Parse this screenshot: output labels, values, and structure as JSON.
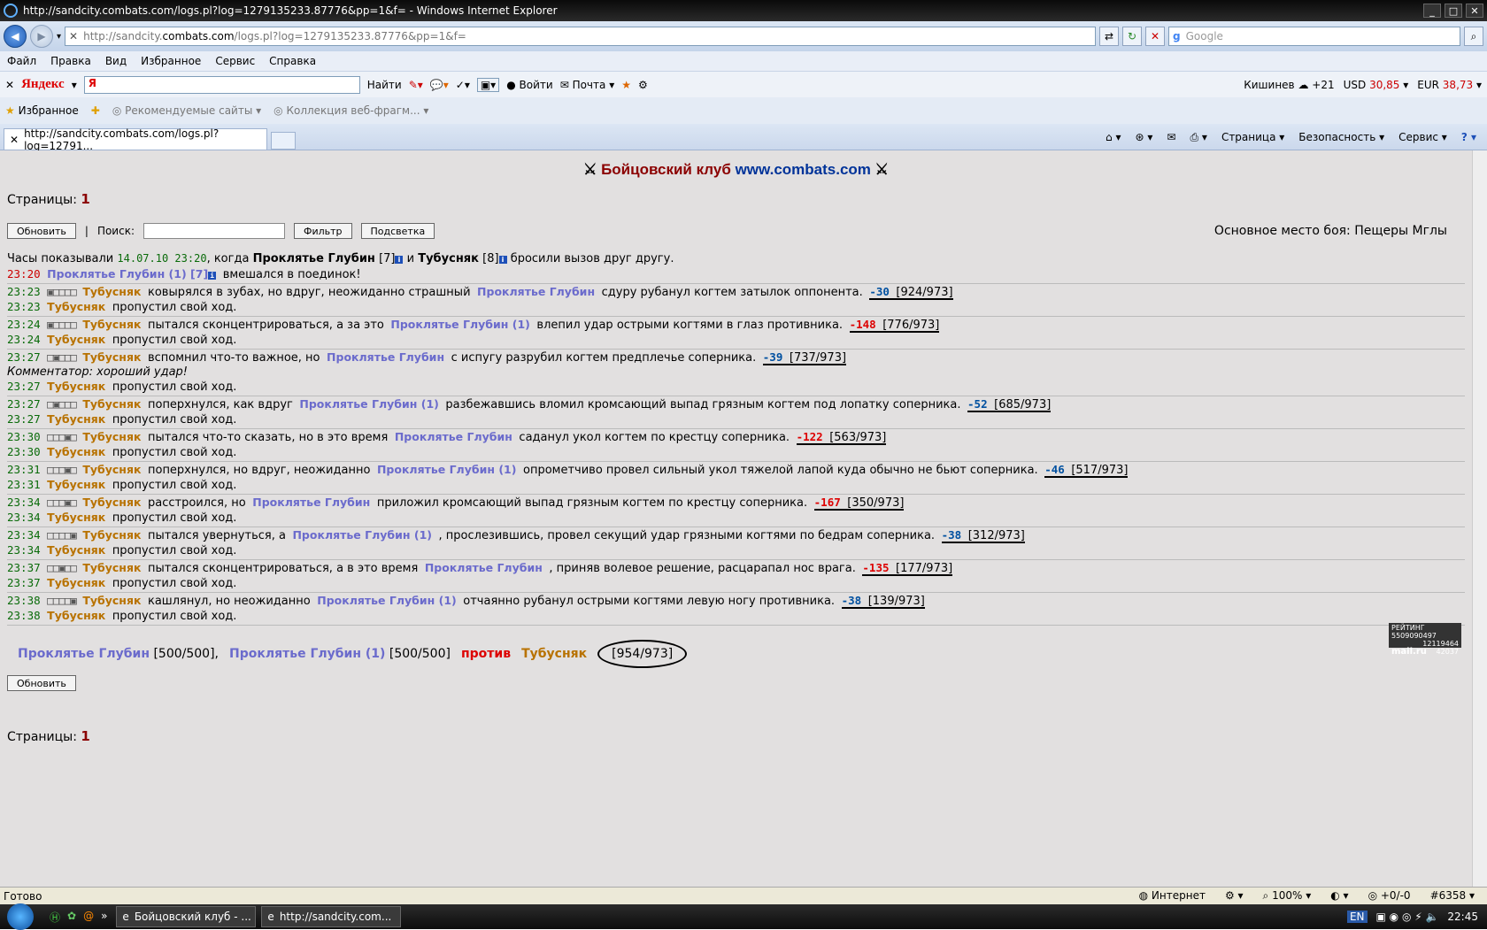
{
  "window": {
    "title": "http://sandcity.combats.com/logs.pl?log=1279135233.87776&pp=1&f= - Windows Internet Explorer"
  },
  "addressbar": {
    "url_prefix": "http://sandcity.",
    "url_domain": "combats.com",
    "url_suffix": "/logs.pl?log=1279135233.87776&pp=1&f=",
    "search_placeholder": "Google"
  },
  "menu": [
    "Файл",
    "Правка",
    "Вид",
    "Избранное",
    "Сервис",
    "Справка"
  ],
  "yandex": {
    "logo": "Яндекс",
    "input": "Я",
    "find": "Найти",
    "login": "Войти",
    "mail": "Почта",
    "city": "Кишинев",
    "temp": "+21",
    "usd_label": "USD",
    "usd": "30,85",
    "eur_label": "EUR",
    "eur": "38,73"
  },
  "favbar": {
    "favorites": "Избранное",
    "suggested": "Рекомендуемые сайты",
    "gallery": "Коллекция веб-фрагм..."
  },
  "tabbar": {
    "tab_title": "http://sandcity.combats.com/logs.pl?log=12791...",
    "page": "Страница",
    "safety": "Безопасность",
    "tools": "Сервис"
  },
  "page": {
    "header_club": "Бойцовский клуб",
    "header_site": "www.combats.com",
    "pages_label": "Страницы:",
    "pages_num": "1",
    "refresh": "Обновить",
    "search_label": "Поиск:",
    "filter": "Фильтр",
    "highlight": "Подсветка",
    "place": "Основное место боя: Пещеры Мглы"
  },
  "intro": {
    "pre": "Часы показывали",
    "date": "14.07.10 23:20",
    "mid": ", когда",
    "p1": "Проклятье Глубин",
    "p1lvl": "[7]",
    "and": "и",
    "p2": "Тубусняк",
    "p2lvl": "[8]",
    "post": "бросили вызов друг другу."
  },
  "intervene": {
    "time": "23:20",
    "name": "Проклятье Глубин (1) [7]",
    "text": "вмешался в поединок!"
  },
  "log": [
    {
      "time": "23:23",
      "sq": "▣□□□□",
      "a": "Тубусняк",
      "t1": "ковырялся в зубах, но вдруг, неожиданно страшный",
      "b": "Проклятье Глубин",
      "t2": "сдуру рубанул когтем затылок оппонента.",
      "dmg": "-30",
      "dcolor": "b",
      "hp": "[924/973]",
      "skip_time": "23:23",
      "skip": "пропустил свой ход.",
      "comment": ""
    },
    {
      "time": "23:24",
      "sq": "▣□□□□",
      "a": "Тубусняк",
      "t1": "пытался сконцентрироваться, а за это",
      "b": "Проклятье Глубин (1)",
      "t2": "влепил удар острыми когтями в глаз противника.",
      "dmg": "-148",
      "dcolor": "r",
      "hp": "[776/973]",
      "skip_time": "23:24",
      "skip": "пропустил свой ход.",
      "comment": ""
    },
    {
      "time": "23:27",
      "sq": "□▣□□□",
      "a": "Тубусняк",
      "t1": "вспомнил что-то важное, но",
      "b": "Проклятье Глубин",
      "t2": "с испугу разрубил когтем предплечье соперника.",
      "dmg": "-39",
      "dcolor": "b",
      "hp": "[737/973]",
      "skip_time": "23:27",
      "skip": "пропустил свой ход.",
      "comment": "Комментатор: хороший удар!"
    },
    {
      "time": "23:27",
      "sq": "□▣□□□",
      "a": "Тубусняк",
      "t1": "поперхнулся, как вдруг",
      "b": "Проклятье Глубин (1)",
      "t2": "разбежавшись вломил кромсающий выпад грязным когтем под лопатку соперника.",
      "dmg": "-52",
      "dcolor": "b",
      "hp": "[685/973]",
      "skip_time": "23:27",
      "skip": "пропустил свой ход.",
      "comment": ""
    },
    {
      "time": "23:30",
      "sq": "□□□▣□",
      "a": "Тубусняк",
      "t1": "пытался что-то сказать, но в это время",
      "b": "Проклятье Глубин",
      "t2": "саданул укол когтем по крестцу соперника.",
      "dmg": "-122",
      "dcolor": "r",
      "hp": "[563/973]",
      "skip_time": "23:30",
      "skip": "пропустил свой ход.",
      "comment": ""
    },
    {
      "time": "23:31",
      "sq": "□□□▣□",
      "a": "Тубусняк",
      "t1": "поперхнулся, но вдруг, неожиданно",
      "b": "Проклятье Глубин (1)",
      "t2": "опрометчиво провел сильный укол тяжелой лапой куда обычно не бьют соперника.",
      "dmg": "-46",
      "dcolor": "b",
      "hp": "[517/973]",
      "skip_time": "23:31",
      "skip": "пропустил свой ход.",
      "comment": ""
    },
    {
      "time": "23:34",
      "sq": "□□□▣□",
      "a": "Тубусняк",
      "t1": "расстроился, но",
      "b": "Проклятье Глубин",
      "t2": "приложил кромсающий выпад грязным когтем по крестцу соперника.",
      "dmg": "-167",
      "dcolor": "r",
      "hp": "[350/973]",
      "skip_time": "23:34",
      "skip": "пропустил свой ход.",
      "comment": ""
    },
    {
      "time": "23:34",
      "sq": "□□□□▣",
      "a": "Тубусняк",
      "t1": "пытался увернуться, а",
      "b": "Проклятье Глубин (1)",
      "t2": ", прослезившись, провел секущий удар грязными когтями по бедрам соперника.",
      "dmg": "-38",
      "dcolor": "b",
      "hp": "[312/973]",
      "skip_time": "23:34",
      "skip": "пропустил свой ход.",
      "comment": ""
    },
    {
      "time": "23:37",
      "sq": "□□▣□□",
      "a": "Тубусняк",
      "t1": "пытался сконцентрироваться, а в это время",
      "b": "Проклятье Глубин",
      "t2": ", приняв волевое решение, расцарапал нос врага.",
      "dmg": "-135",
      "dcolor": "r",
      "hp": "[177/973]",
      "skip_time": "23:37",
      "skip": "пропустил свой ход.",
      "comment": ""
    },
    {
      "time": "23:38",
      "sq": "□□□□▣",
      "a": "Тубусняк",
      "t1": "кашлянул, но неожиданно",
      "b": "Проклятье Глубин (1)",
      "t2": "отчаянно рубанул острыми когтями левую ногу противника.",
      "dmg": "-38",
      "dcolor": "b",
      "hp": "[139/973]",
      "skip_time": "23:38",
      "skip": "пропустил свой ход.",
      "comment": ""
    }
  ],
  "summary": {
    "t1a": "Проклятье Глубин",
    "t1a_hp": "[500/500],",
    "t1b": "Проклятье Глубин (1)",
    "t1b_hp": "[500/500]",
    "vs": "против",
    "t2": "Тубусняк",
    "t2_hp": "[954/973]"
  },
  "counter": {
    "line1": "РЕЙТИНГ 5509090497",
    "line2": "12119464",
    "line3": "42037",
    "brand": "mail.ru"
  },
  "statusbar": {
    "left": "Готово",
    "zone": "Интернет",
    "zoom": "100%",
    "extra1": "+0/-0",
    "extra2": "#6358"
  },
  "taskbar": {
    "task1": "Бойцовский клуб - ...",
    "task2": "http://sandcity.com...",
    "lang": "EN",
    "time": "22:45"
  }
}
